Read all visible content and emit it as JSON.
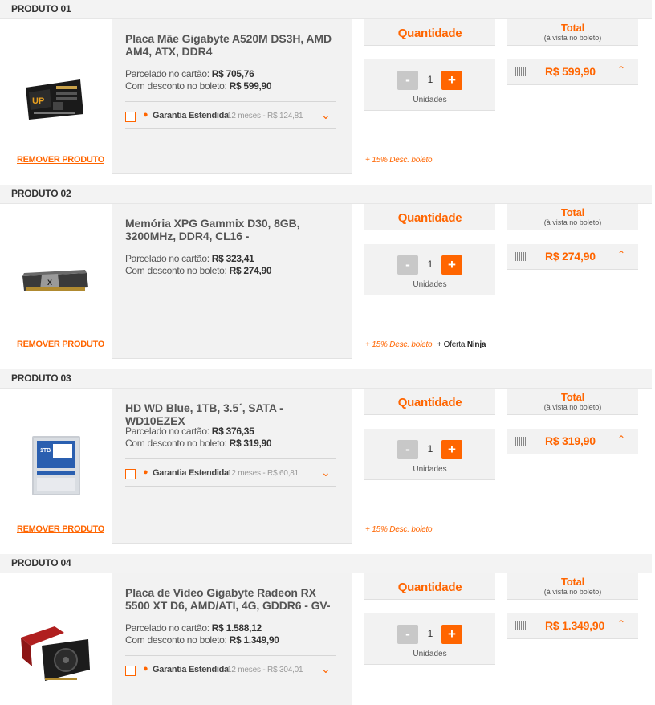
{
  "products": [
    {
      "header": "PRODUTO 01",
      "name": "Placa Mãe Gigabyte A520M DS3H, AMD AM4, ATX, DDR4",
      "parcelado_label": "Parcelado no cartão:",
      "parcelado_value": "R$ 705,76",
      "boleto_label": "Com desconto no boleto:",
      "boleto_value": "R$ 599,90",
      "garantia_label": "Garantia Estendida",
      "garantia_price": "12 meses - R$ 124,81",
      "remove_label": "REMOVER PRODUTO",
      "quantity_title": "Quantidade",
      "quantity": "1",
      "unit_label": "Unidades",
      "minus_label": "-",
      "plus_label": "+",
      "desc_boleto": "+ 15% Desc. boleto",
      "total_title": "Total",
      "total_sub": "(à vista no boleto)",
      "total_value": "R$ 599,90",
      "image_icon": "motherboard-image"
    },
    {
      "header": "PRODUTO 02",
      "name": "Memória XPG Gammix D30, 8GB, 3200MHz, DDR4, CL16 -",
      "parcelado_label": "Parcelado no cartão:",
      "parcelado_value": "R$ 323,41",
      "boleto_label": "Com desconto no boleto:",
      "boleto_value": "R$ 274,90",
      "remove_label": "REMOVER PRODUTO",
      "quantity_title": "Quantidade",
      "quantity": "1",
      "unit_label": "Unidades",
      "minus_label": "-",
      "plus_label": "+",
      "desc_boleto": "+ 15% Desc. boleto",
      "desc_extra_prefix": "+ Oferta",
      "desc_extra_bold": "Ninja",
      "total_title": "Total",
      "total_sub": "(à vista no boleto)",
      "total_value": "R$ 274,90",
      "image_icon": "ram-memory-image"
    },
    {
      "header": "PRODUTO 03",
      "name": "HD WD Blue, 1TB, 3.5´, SATA - WD10EZEX",
      "parcelado_label": "Parcelado no cartão:",
      "parcelado_value": "R$ 376,35",
      "boleto_label": "Com desconto no boleto:",
      "boleto_value": "R$ 319,90",
      "garantia_label": "Garantia Estendida",
      "garantia_price": "12 meses - R$ 60,81",
      "remove_label": "REMOVER PRODUTO",
      "quantity_title": "Quantidade",
      "quantity": "1",
      "unit_label": "Unidades",
      "minus_label": "-",
      "plus_label": "+",
      "desc_boleto": "+ 15% Desc. boleto",
      "total_title": "Total",
      "total_sub": "(à vista no boleto)",
      "total_value": "R$ 319,90",
      "image_icon": "hard-drive-image"
    },
    {
      "header": "PRODUTO 04",
      "name": "Placa de Vídeo Gigabyte Radeon RX 5500 XT D6, AMD/ATI, 4G, GDDR6 - GV-",
      "parcelado_label": "Parcelado no cartão:",
      "parcelado_value": "R$ 1.588,12",
      "boleto_label": "Com desconto no boleto:",
      "boleto_value": "R$ 1.349,90",
      "garantia_label": "Garantia Estendida",
      "garantia_price": "12 meses - R$ 304,01",
      "quantity_title": "Quantidade",
      "quantity": "1",
      "unit_label": "Unidades",
      "minus_label": "-",
      "plus_label": "+",
      "total_title": "Total",
      "total_sub": "(à vista no boleto)",
      "total_value": "R$ 1.349,90",
      "image_icon": "graphics-card-image"
    }
  ],
  "colors": {
    "accent": "#ff6500",
    "panel": "#f2f2f2",
    "header": "#f3f3f3"
  }
}
